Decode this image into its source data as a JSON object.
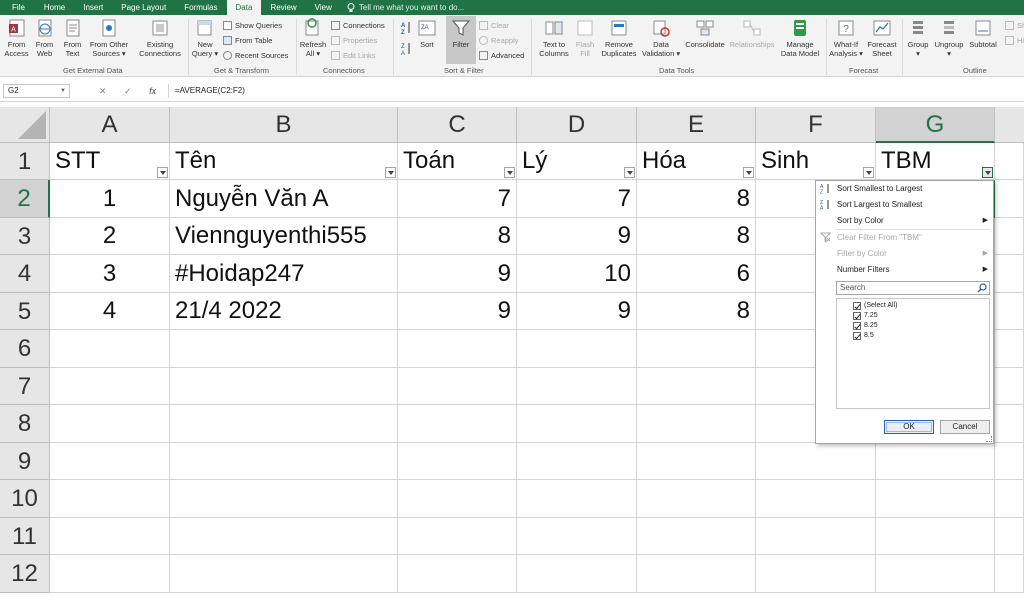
{
  "menu": {
    "tabs": [
      "File",
      "Home",
      "Insert",
      "Page Layout",
      "Formulas",
      "Data",
      "Review",
      "View"
    ],
    "active": "Data",
    "tellme": "Tell me what you want to do..."
  },
  "ribbon": {
    "get_external": {
      "from_access": [
        "From",
        "Access"
      ],
      "from_web": [
        "From",
        "Web"
      ],
      "from_text": [
        "From",
        "Text"
      ],
      "from_other": [
        "From Other",
        "Sources ▾"
      ],
      "existing": [
        "Existing",
        "Connections"
      ],
      "label": "Get External Data"
    },
    "get_transform": {
      "new_query": [
        "New",
        "Query ▾"
      ],
      "show_queries": "Show Queries",
      "from_table": "From Table",
      "recent_sources": "Recent Sources",
      "label": "Get & Transform"
    },
    "connections": {
      "refresh_all": [
        "Refresh",
        "All ▾"
      ],
      "connections": "Connections",
      "properties": "Properties",
      "edit_links": "Edit Links",
      "label": "Connections"
    },
    "sort_filter": {
      "sort": "Sort",
      "filter": "Filter",
      "clear": "Clear",
      "reapply": "Reapply",
      "advanced": "Advanced",
      "label": "Sort & Filter"
    },
    "data_tools": {
      "text_to_columns": [
        "Text to",
        "Columns"
      ],
      "flash_fill": [
        "Flash",
        "Fill"
      ],
      "remove_duplicates": [
        "Remove",
        "Duplicates"
      ],
      "data_validation": [
        "Data",
        "Validation ▾"
      ],
      "consolidate": "Consolidate",
      "relationships": "Relationships",
      "manage_data_model": [
        "Manage",
        "Data Model"
      ],
      "label": "Data Tools"
    },
    "forecast": {
      "what_if": [
        "What-If",
        "Analysis ▾"
      ],
      "forecast_sheet": [
        "Forecast",
        "Sheet"
      ],
      "label": "Forecast"
    },
    "outline": {
      "group": [
        "Group",
        "▾"
      ],
      "ungroup": [
        "Ungroup",
        "▾"
      ],
      "subtotal": "Subtotal",
      "show": "Sh",
      "hide": "Hi",
      "label": "Outline"
    }
  },
  "formula_bar": {
    "name_box": "G2",
    "cancel": "✕",
    "enter": "✓",
    "fx": "fx",
    "formula": "=AVERAGE(C2:F2)"
  },
  "columns": [
    "A",
    "B",
    "C",
    "D",
    "E",
    "F",
    "G"
  ],
  "rows": [
    "1",
    "2",
    "3",
    "4",
    "5",
    "6",
    "7",
    "8",
    "9",
    "10",
    "11",
    "12"
  ],
  "sheet": {
    "headers": [
      "STT",
      "Tên",
      "Toán",
      "Lý",
      "Hóa",
      "Sinh",
      "TBM"
    ],
    "data": [
      [
        "1",
        "Nguyễn Văn A",
        "7",
        "7",
        "8"
      ],
      [
        "2",
        "Viennguyenthi555",
        "8",
        "9",
        "8"
      ],
      [
        "3",
        "#Hoidap247",
        "9",
        "10",
        "6"
      ],
      [
        "4",
        "21/4 2022",
        "9",
        "9",
        "8"
      ]
    ]
  },
  "filter_menu": {
    "sort_asc": "Sort Smallest to Largest",
    "sort_desc": "Sort Largest to Smallest",
    "sort_color": "Sort by Color",
    "clear_filter": "Clear Filter From \"TBM\"",
    "filter_color": "Filter by Color",
    "number_filters": "Number Filters",
    "search_placeholder": "Search",
    "items": [
      "(Select All)",
      "7.25",
      "8.25",
      "8.5"
    ],
    "ok": "OK",
    "cancel": "Cancel"
  }
}
